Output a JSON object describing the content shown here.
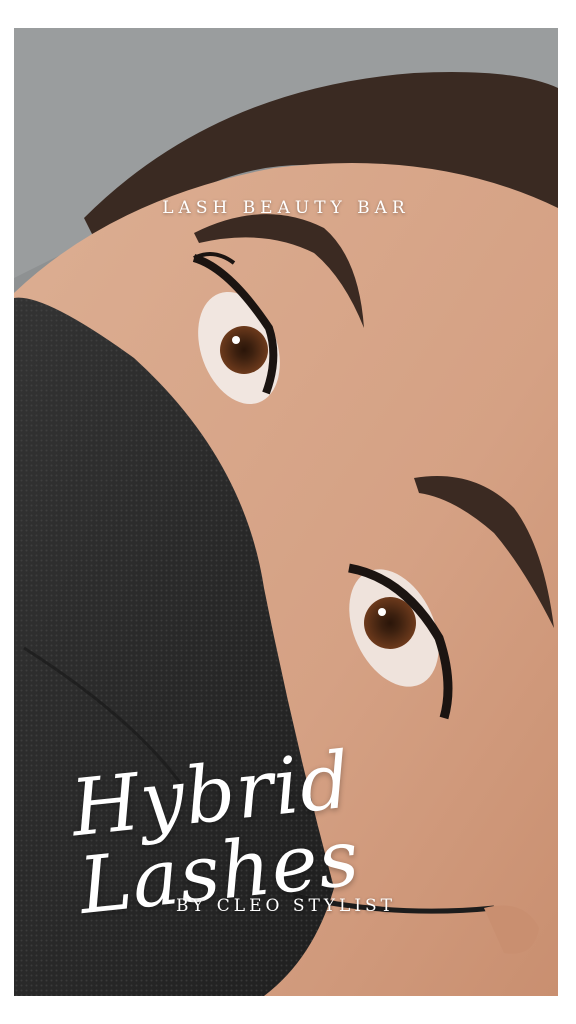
{
  "overlay": {
    "brand": "LASH BEAUTY BAR",
    "title": "Hybrid Lashes",
    "byline": "BY CLEO STYLIST"
  },
  "colors": {
    "border": "#ffffff",
    "skin": "#d9a98e",
    "mask": "#2a2a2a",
    "hair": "#3a2a22",
    "backdrop": "#8e9192",
    "text": "#ffffff"
  }
}
